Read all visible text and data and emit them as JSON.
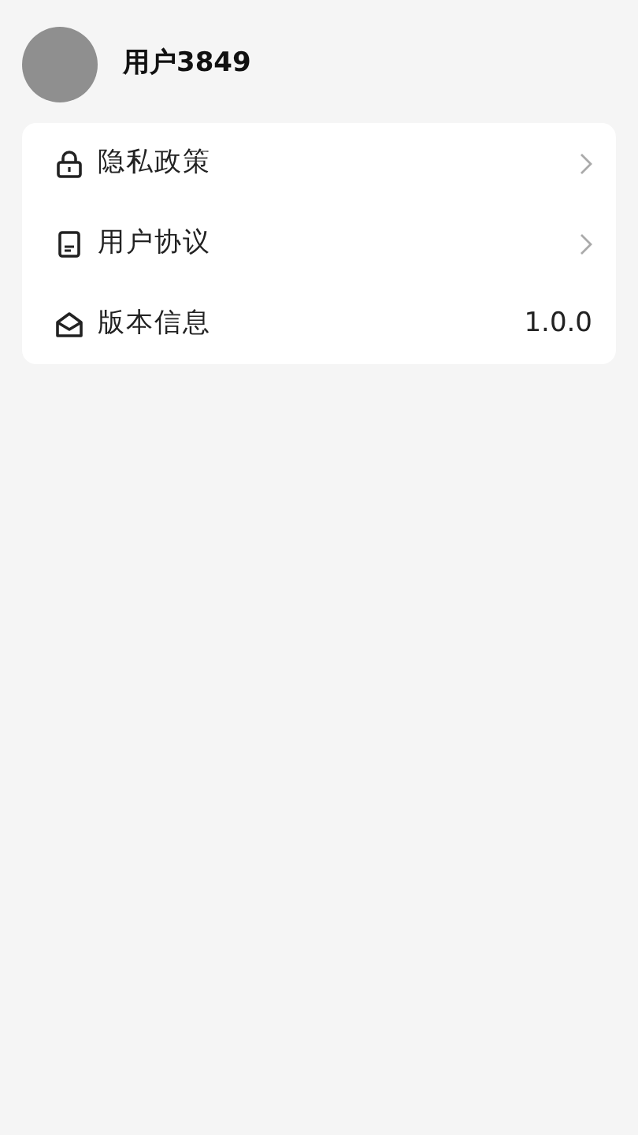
{
  "profile": {
    "username": "用户3849"
  },
  "menu": [
    {
      "label": "隐私政策",
      "kind": "link"
    },
    {
      "label": "用户协议",
      "kind": "link"
    },
    {
      "label": "版本信息",
      "kind": "value",
      "value": "1.0.0"
    }
  ]
}
